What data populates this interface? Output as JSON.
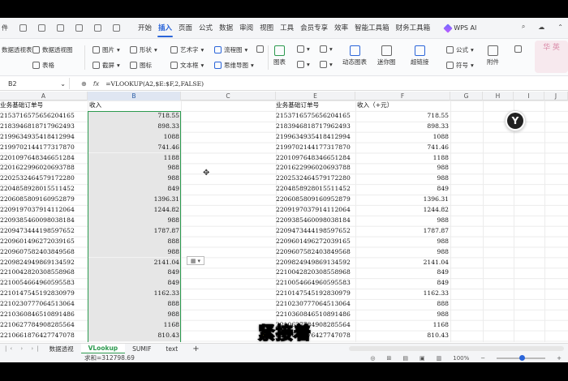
{
  "menubar": {
    "left": [
      "件",
      "",
      "",
      "",
      ""
    ],
    "tabs": [
      "开始",
      "插入",
      "页面",
      "公式",
      "数据",
      "审阅",
      "视图",
      "工具",
      "会员专享",
      "效率",
      "智能工具箱",
      "财务工具箱"
    ],
    "active_tab": "插入",
    "wps_ai": "WPS AI"
  },
  "ribbon": {
    "left_labels": [
      "数据透视表",
      "数据透视图",
      "表格"
    ],
    "picture": "图片",
    "shape": "形状",
    "screenshot": "截屏",
    "icon": "图标",
    "art_text": "艺术字",
    "textbox": "文本框",
    "flowchart": "流程图",
    "mindmap": "思维导图",
    "more": "更多",
    "chart": "图表",
    "dynamic_chart": "动态图表",
    "sparkline": "迷你图",
    "hyperlink": "超链接",
    "formula": "公式",
    "symbol": "符号",
    "attachment": "附件"
  },
  "formula_bar": {
    "name_box": "B2",
    "formula": "=VLOOKUP(A2,$E:$F,2,FALSE)"
  },
  "columns": [
    "A",
    "B",
    "C",
    "",
    "E",
    "F",
    "G",
    "H",
    "I",
    "J"
  ],
  "headers": {
    "A": "业务基础订单号",
    "B": "收入",
    "E": "业务基础订单号",
    "F": "收入（+元）"
  },
  "rows": [
    {
      "a": "2153716575656204165",
      "b": "718.55",
      "e": "2153716575656204165",
      "f": "718.55"
    },
    {
      "a": "2183946818717962493",
      "b": "898.33",
      "e": "2183946818717962493",
      "f": "898.33"
    },
    {
      "a": "2199634935418412994",
      "b": "1088",
      "e": "2199634935418412994",
      "f": "1088"
    },
    {
      "a": "2199702144177317870",
      "b": "741.46",
      "e": "2199702144177317870",
      "f": "741.46"
    },
    {
      "a": "2201097648346651284",
      "b": "1188",
      "e": "2201097648346651284",
      "f": "1188"
    },
    {
      "a": "2201622996020693788",
      "b": "988",
      "e": "2201622996020693788",
      "f": "988"
    },
    {
      "a": "2202532464579172280",
      "b": "988",
      "e": "2202532464579172280",
      "f": "988"
    },
    {
      "a": "2204858928015511452",
      "b": "849",
      "e": "2204858928015511452",
      "f": "849"
    },
    {
      "a": "2206085809160952879",
      "b": "1396.31",
      "e": "2206085809160952879",
      "f": "1396.31"
    },
    {
      "a": "2209197037914112064",
      "b": "1244.82",
      "e": "2209197037914112064",
      "f": "1244.82"
    },
    {
      "a": "2209385460098038184",
      "b": "988",
      "e": "2209385460098038184",
      "f": "988"
    },
    {
      "a": "2209473444198597652",
      "b": "1787.87",
      "e": "2209473444198597652",
      "f": "1787.87"
    },
    {
      "a": "2209601496272039165",
      "b": "888",
      "e": "2209601496272039165",
      "f": "988"
    },
    {
      "a": "2209607582403849568",
      "b": "988",
      "e": "2209607582403849568",
      "f": "988"
    },
    {
      "a": "2209824949869134592",
      "b": "2141.04",
      "e": "2209824949869134592",
      "f": "2141.04"
    },
    {
      "a": "2210042820308558968",
      "b": "849",
      "e": "2210042820308558968",
      "f": "849"
    },
    {
      "a": "2210054664960595583",
      "b": "849",
      "e": "2210054664960595583",
      "f": "849"
    },
    {
      "a": "2210147545192830979",
      "b": "1162.33",
      "e": "2210147545192830979",
      "f": "1162.33"
    },
    {
      "a": "2210230777064513064",
      "b": "888",
      "e": "2210230777064513064",
      "f": "888"
    },
    {
      "a": "2210360846510891486",
      "b": "988",
      "e": "2210360846510891486",
      "f": "988"
    },
    {
      "a": "2210627784908285564",
      "b": "1168",
      "e": "2210627784908285564",
      "f": "1168"
    },
    {
      "a": "2210661876427747078",
      "b": "810.43",
      "e": "2210661876427747078",
      "f": "810.43"
    }
  ],
  "sheet_tabs": [
    "数据透视",
    "VLookup",
    "SUMIF",
    "text"
  ],
  "active_sheet": "VLookup",
  "status": {
    "sum": "求和=312798.69",
    "zoom": "100%"
  },
  "subtitle": "紧接着",
  "avatar_text": "华 英",
  "colors": {
    "accent": "#2b65d9",
    "selection": "#2c9a4f"
  }
}
